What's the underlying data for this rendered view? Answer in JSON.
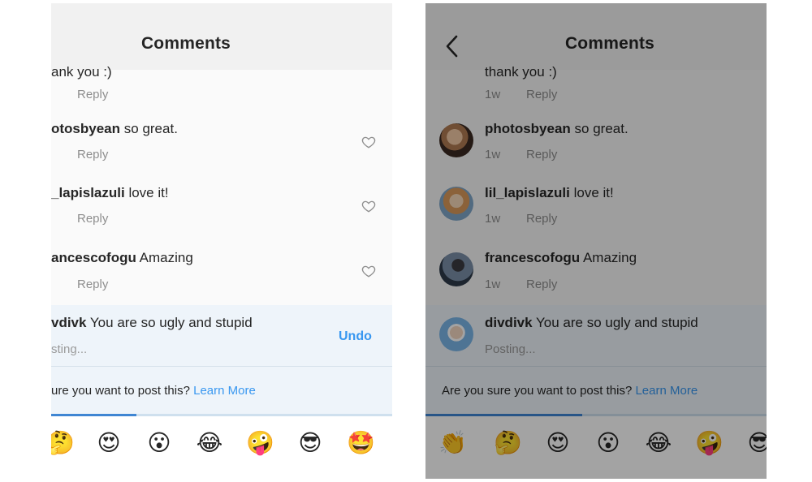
{
  "left": {
    "title": "Comments",
    "comments": [
      {
        "text": "ank you :)",
        "reply": "Reply"
      },
      {
        "user": "otosbyean",
        "text": "so great.",
        "reply": "Reply"
      },
      {
        "user": "_lapislazuli",
        "text": "love it!",
        "reply": "Reply"
      },
      {
        "user": "ancescofogu",
        "text": "Amazing",
        "reply": "Reply"
      }
    ],
    "pending": {
      "user": "vdivk",
      "text": "You are so ugly and stupid",
      "status": "sting...",
      "undo": "Undo"
    },
    "warning": {
      "text": "ure you want to post this?",
      "link": "Learn More"
    },
    "progress": 0.25,
    "emojis": [
      "🤔",
      "😍",
      "😮",
      "😂",
      "🤪",
      "😎",
      "🤩"
    ]
  },
  "right": {
    "title": "Comments",
    "comments": [
      {
        "text": "thank you :)",
        "time": "1w",
        "reply": "Reply"
      },
      {
        "user": "photosbyean",
        "text": "so great.",
        "time": "1w",
        "reply": "Reply"
      },
      {
        "user": "lil_lapislazuli",
        "text": "love it!",
        "time": "1w",
        "reply": "Reply"
      },
      {
        "user": "francescofogu",
        "text": "Amazing",
        "time": "1w",
        "reply": "Reply"
      }
    ],
    "pending": {
      "user": "divdivk",
      "text": "You are so ugly and stupid",
      "status": "Posting..."
    },
    "warning": {
      "text": "Are you sure you want to post this?",
      "link": "Learn More"
    },
    "progress": 0.46,
    "emojis": [
      "👏",
      "🤔",
      "😍",
      "😮",
      "😂",
      "🤪",
      "😎"
    ]
  },
  "colors": {
    "accent": "#3897f0",
    "progress": "#3f86d3",
    "pending_bg": "#eef4fa",
    "muted": "#8e8e8e"
  }
}
